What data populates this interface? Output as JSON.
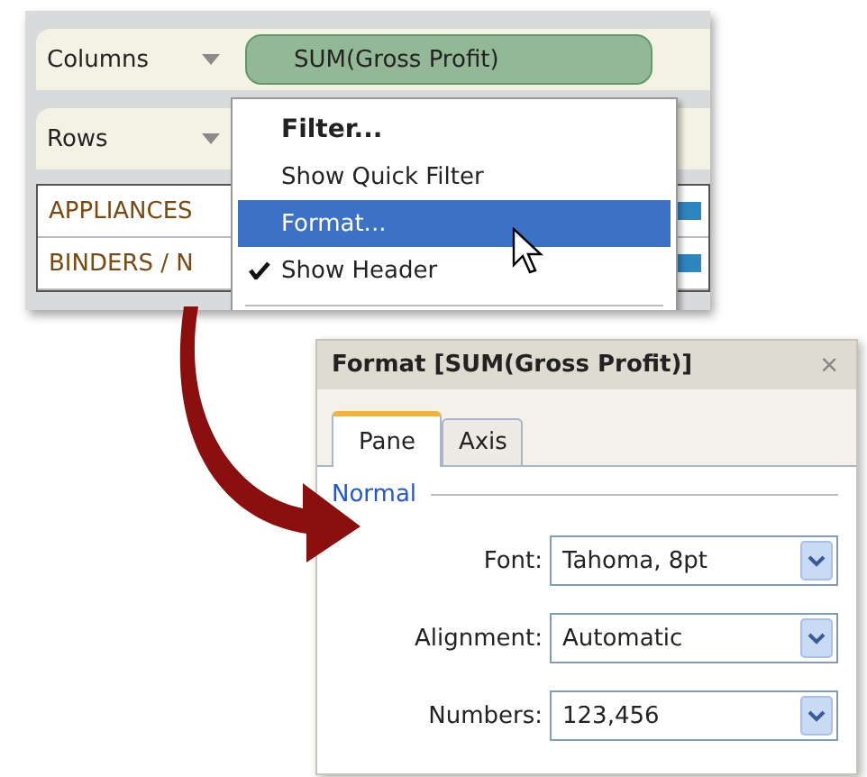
{
  "shelves": [
    {
      "label": "Columns",
      "pill": "SUM(Gross Profit)"
    },
    {
      "label": "Rows"
    }
  ],
  "table_rows": [
    "APPLIANCES",
    "BINDERS / N"
  ],
  "context_menu": [
    {
      "label": "Filter...",
      "kind": "bold",
      "selected": false,
      "checked": false
    },
    {
      "label": "Show Quick Filter",
      "kind": "plain",
      "selected": false,
      "checked": false
    },
    {
      "label": "Format...",
      "kind": "plain",
      "selected": true,
      "checked": false
    },
    {
      "label": "Show Header",
      "kind": "plain",
      "selected": false,
      "checked": true
    }
  ],
  "format_panel": {
    "title": "Format [SUM(Gross Profit)]",
    "close": "×",
    "tabs": [
      {
        "label": "Pane",
        "selected": true
      },
      {
        "label": "Axis",
        "selected": false
      }
    ],
    "section": "Normal",
    "fields": [
      {
        "label": "Font:",
        "value": "Tahoma, 8pt"
      },
      {
        "label": "Alignment:",
        "value": "Automatic"
      },
      {
        "label": "Numbers:",
        "value": "123,456"
      }
    ]
  }
}
